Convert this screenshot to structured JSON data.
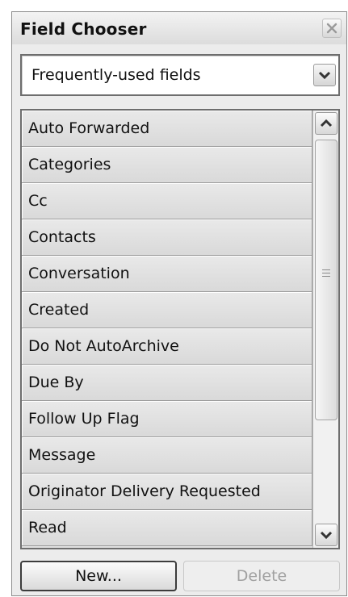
{
  "window": {
    "title": "Field Chooser"
  },
  "dropdown": {
    "selected": "Frequently-used fields"
  },
  "fields": [
    "Auto Forwarded",
    "Categories",
    "Cc",
    "Contacts",
    "Conversation",
    "Created",
    "Do Not AutoArchive",
    "Due By",
    "Follow Up Flag",
    "Message",
    "Originator Delivery Requested",
    "Read"
  ],
  "buttons": {
    "new_label": "New...",
    "delete_label": "Delete"
  },
  "icons": {
    "close": "close-icon",
    "dropdown": "chevron-down-icon",
    "scroll_up": "chevron-up-icon",
    "scroll_down": "chevron-down-icon",
    "thumb_grip": "grip-icon"
  },
  "colors": {
    "window_bg": "#ececec",
    "list_item_bg": "#e2e2e2",
    "text": "#111111",
    "disabled_text": "#a0a0a0",
    "border": "#6e6e6e"
  }
}
